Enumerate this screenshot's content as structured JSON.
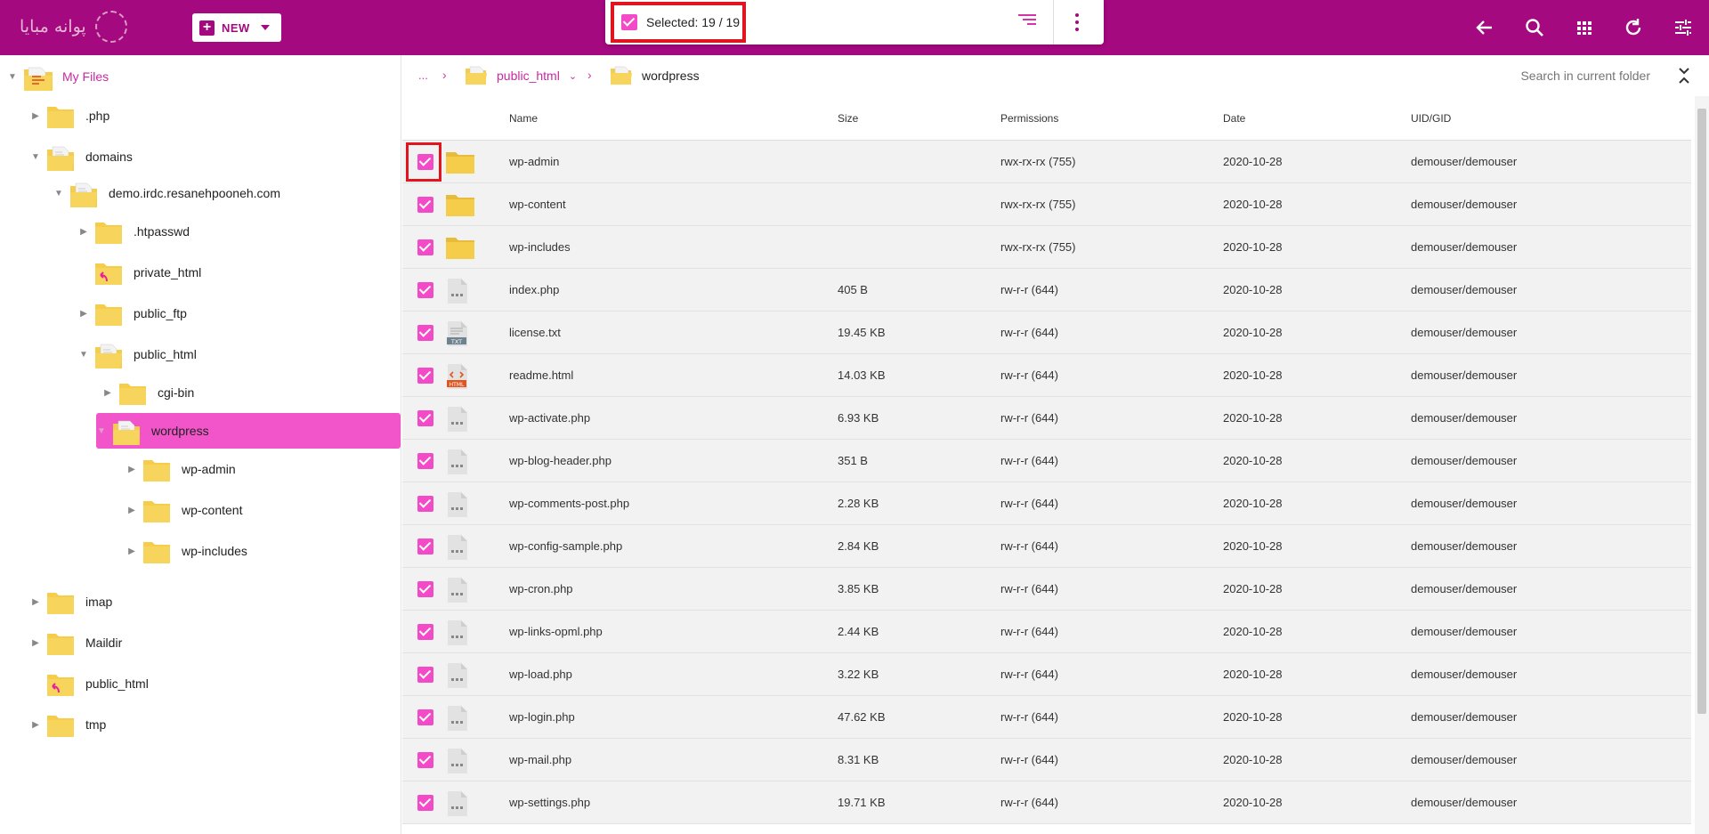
{
  "colors": {
    "brand": "#a4097f",
    "accent": "#f155c9",
    "checkbox": "#f34bc7",
    "highlight": "#e0151f",
    "folder": "#f5cd4b"
  },
  "header": {
    "logo_text": "پوانه مبایا",
    "new_label": "NEW",
    "selection_text": "Selected: 19 / 19",
    "icons": [
      "sort-icon",
      "more-vert-icon",
      "back-arrow-icon",
      "search-icon",
      "grid-view-icon",
      "refresh-icon",
      "settings-sliders-icon"
    ]
  },
  "sidebar": {
    "items": [
      {
        "label": "My Files",
        "expanded": true,
        "icon": "root-folder-icon"
      },
      {
        "label": ".php",
        "expanded": false,
        "icon": "folder-icon"
      },
      {
        "label": "domains",
        "expanded": true,
        "icon": "folder-open-icon"
      },
      {
        "label": "demo.irdc.resanehpooneh.com",
        "expanded": true,
        "icon": "folder-open-icon"
      },
      {
        "label": ".htpasswd",
        "expanded": false,
        "icon": "folder-icon"
      },
      {
        "label": "private_html",
        "expanded": false,
        "icon": "folder-link-icon"
      },
      {
        "label": "public_ftp",
        "expanded": false,
        "icon": "folder-icon"
      },
      {
        "label": "public_html",
        "expanded": true,
        "icon": "folder-open-icon"
      },
      {
        "label": "cgi-bin",
        "expanded": false,
        "icon": "folder-icon"
      },
      {
        "label": "wordpress",
        "expanded": true,
        "selected": true,
        "icon": "folder-open-icon"
      },
      {
        "label": "wp-admin",
        "expanded": false,
        "icon": "folder-icon"
      },
      {
        "label": "wp-content",
        "expanded": false,
        "icon": "folder-icon"
      },
      {
        "label": "wp-includes",
        "expanded": false,
        "icon": "folder-icon"
      },
      {
        "label": "imap",
        "expanded": false,
        "icon": "folder-icon"
      },
      {
        "label": "Maildir",
        "expanded": false,
        "icon": "folder-icon"
      },
      {
        "label": "public_html",
        "expanded": false,
        "icon": "folder-link-icon"
      },
      {
        "label": "tmp",
        "expanded": false,
        "icon": "folder-icon"
      }
    ]
  },
  "breadcrumb": {
    "ellipsis": "...",
    "items": [
      "public_html",
      "wordpress"
    ]
  },
  "search": {
    "placeholder": "Search in current folder"
  },
  "table": {
    "columns": [
      "Name",
      "Size",
      "Permissions",
      "Date",
      "UID/GID"
    ],
    "rows": [
      {
        "name": "wp-admin",
        "type": "folder",
        "size": "",
        "permissions": "rwx-rx-rx (755)",
        "date": "2020-10-28",
        "owner": "demouser/demouser",
        "checked": true
      },
      {
        "name": "wp-content",
        "type": "folder",
        "size": "",
        "permissions": "rwx-rx-rx (755)",
        "date": "2020-10-28",
        "owner": "demouser/demouser",
        "checked": true
      },
      {
        "name": "wp-includes",
        "type": "folder",
        "size": "",
        "permissions": "rwx-rx-rx (755)",
        "date": "2020-10-28",
        "owner": "demouser/demouser",
        "checked": true
      },
      {
        "name": "index.php",
        "type": "file",
        "size": "405 B",
        "permissions": "rw-r-r (644)",
        "date": "2020-10-28",
        "owner": "demouser/demouser",
        "checked": true
      },
      {
        "name": "license.txt",
        "type": "txt",
        "size": "19.45 KB",
        "permissions": "rw-r-r (644)",
        "date": "2020-10-28",
        "owner": "demouser/demouser",
        "checked": true
      },
      {
        "name": "readme.html",
        "type": "html",
        "size": "14.03 KB",
        "permissions": "rw-r-r (644)",
        "date": "2020-10-28",
        "owner": "demouser/demouser",
        "checked": true
      },
      {
        "name": "wp-activate.php",
        "type": "file",
        "size": "6.93 KB",
        "permissions": "rw-r-r (644)",
        "date": "2020-10-28",
        "owner": "demouser/demouser",
        "checked": true
      },
      {
        "name": "wp-blog-header.php",
        "type": "file",
        "size": "351 B",
        "permissions": "rw-r-r (644)",
        "date": "2020-10-28",
        "owner": "demouser/demouser",
        "checked": true
      },
      {
        "name": "wp-comments-post.php",
        "type": "file",
        "size": "2.28 KB",
        "permissions": "rw-r-r (644)",
        "date": "2020-10-28",
        "owner": "demouser/demouser",
        "checked": true
      },
      {
        "name": "wp-config-sample.php",
        "type": "file",
        "size": "2.84 KB",
        "permissions": "rw-r-r (644)",
        "date": "2020-10-28",
        "owner": "demouser/demouser",
        "checked": true
      },
      {
        "name": "wp-cron.php",
        "type": "file",
        "size": "3.85 KB",
        "permissions": "rw-r-r (644)",
        "date": "2020-10-28",
        "owner": "demouser/demouser",
        "checked": true
      },
      {
        "name": "wp-links-opml.php",
        "type": "file",
        "size": "2.44 KB",
        "permissions": "rw-r-r (644)",
        "date": "2020-10-28",
        "owner": "demouser/demouser",
        "checked": true
      },
      {
        "name": "wp-load.php",
        "type": "file",
        "size": "3.22 KB",
        "permissions": "rw-r-r (644)",
        "date": "2020-10-28",
        "owner": "demouser/demouser",
        "checked": true
      },
      {
        "name": "wp-login.php",
        "type": "file",
        "size": "47.62 KB",
        "permissions": "rw-r-r (644)",
        "date": "2020-10-28",
        "owner": "demouser/demouser",
        "checked": true
      },
      {
        "name": "wp-mail.php",
        "type": "file",
        "size": "8.31 KB",
        "permissions": "rw-r-r (644)",
        "date": "2020-10-28",
        "owner": "demouser/demouser",
        "checked": true
      },
      {
        "name": "wp-settings.php",
        "type": "file",
        "size": "19.71 KB",
        "permissions": "rw-r-r (644)",
        "date": "2020-10-28",
        "owner": "demouser/demouser",
        "checked": true
      }
    ]
  },
  "file_badges": {
    "txt": "TXT",
    "html": "HTML"
  }
}
